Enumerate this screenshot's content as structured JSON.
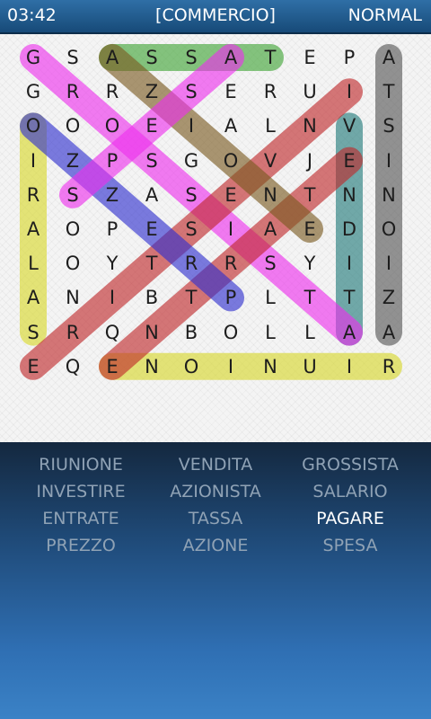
{
  "header": {
    "timer": "03:42",
    "category": "[COMMERCIO]",
    "mode": "NORMAL"
  },
  "grid": [
    "GSASSATEPA",
    "GRRZSERUIT",
    "OOOEIALNVS",
    "IZPSGOVJEI",
    "RSZASENTNN",
    "AOPESIAEDO",
    "LOYTRRSYII",
    "ANIBTPLTTZ",
    "SRQNBOLLAA",
    "EQENOINUIR"
  ],
  "found_words": [
    {
      "word": "ASSAT",
      "color": "#3fa535",
      "start": [
        0,
        2
      ],
      "end": [
        0,
        6
      ]
    },
    {
      "word": "AZIONISTA",
      "color": "#555555",
      "start": [
        0,
        9
      ],
      "end": [
        8,
        9
      ]
    },
    {
      "word": "SALARIO",
      "color": "#d9d92a",
      "start": [
        8,
        0
      ],
      "end": [
        2,
        0
      ]
    },
    {
      "word": "RIUNIONE",
      "color": "#d8d82a",
      "start": [
        9,
        9
      ],
      "end": [
        9,
        2
      ]
    },
    {
      "word": "VENDITA",
      "color": "#217a7a",
      "start": [
        2,
        8
      ],
      "end": [
        8,
        8
      ]
    },
    {
      "word": "GROSSISTA",
      "color": "#ee2fee",
      "start": [
        0,
        0
      ],
      "end": [
        8,
        8
      ]
    },
    {
      "word": "INVESTIRE",
      "color": "#c0282a",
      "start": [
        1,
        8
      ],
      "end": [
        9,
        0
      ]
    },
    {
      "word": "ENTRATE",
      "color": "#c0282a",
      "start": [
        3,
        8
      ],
      "end": [
        9,
        2
      ]
    },
    {
      "word": "PREZZO",
      "color": "#2f2fcf",
      "start": [
        7,
        5
      ],
      "end": [
        2,
        0
      ]
    },
    {
      "word": "TASSA",
      "color": "#7a5a20",
      "start": [
        0,
        2
      ],
      "end": [
        5,
        7
      ]
    },
    {
      "word": "SPESA",
      "color": "#ee2fee",
      "start": [
        0,
        5
      ],
      "end": [
        4,
        1
      ]
    }
  ],
  "word_list": [
    {
      "label": "RIUNIONE",
      "active": false
    },
    {
      "label": "VENDITA",
      "active": false
    },
    {
      "label": "GROSSISTA",
      "active": false
    },
    {
      "label": "INVESTIRE",
      "active": false
    },
    {
      "label": "AZIONISTA",
      "active": false
    },
    {
      "label": "SALARIO",
      "active": false
    },
    {
      "label": "ENTRATE",
      "active": false
    },
    {
      "label": "TASSA",
      "active": false
    },
    {
      "label": "PAGARE",
      "active": true
    },
    {
      "label": "PREZZO",
      "active": false
    },
    {
      "label": "AZIONE",
      "active": false
    },
    {
      "label": "SPESA",
      "active": false
    }
  ]
}
